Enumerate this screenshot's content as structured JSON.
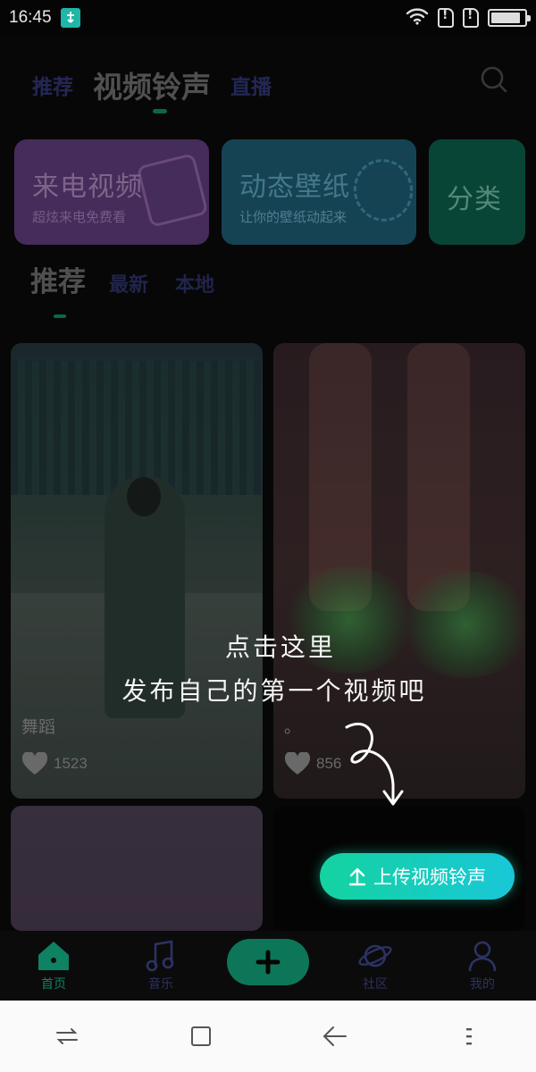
{
  "status_bar": {
    "time": "16:45",
    "battery_level": 0.9
  },
  "header": {
    "tabs": [
      {
        "label": "推荐",
        "active": false
      },
      {
        "label": "视频铃声",
        "active": true
      },
      {
        "label": "直播",
        "active": false
      }
    ]
  },
  "categories": [
    {
      "title": "来电视频",
      "subtitle": "超炫来电免费看"
    },
    {
      "title": "动态壁纸",
      "subtitle": "让你的壁纸动起来"
    },
    {
      "title": "分类",
      "subtitle": ""
    }
  ],
  "sub_tabs": [
    {
      "label": "推荐",
      "active": true
    },
    {
      "label": "最新",
      "active": false
    },
    {
      "label": "本地",
      "active": false
    }
  ],
  "videos": [
    {
      "title": "舞蹈",
      "likes": "1523"
    },
    {
      "title": "。",
      "likes": "856"
    }
  ],
  "guide": {
    "line1": "点击这里",
    "line2": "发布自己的第一个视频吧"
  },
  "upload_button": {
    "label": "上传视频铃声"
  },
  "bottom_nav": [
    {
      "label": "首页",
      "active": true
    },
    {
      "label": "音乐",
      "active": false
    },
    {
      "label": "",
      "active": false
    },
    {
      "label": "社区",
      "active": false
    },
    {
      "label": "我的",
      "active": false
    }
  ],
  "colors": {
    "accent": "#0e8262",
    "upload_gradient_start": "#14d3a0",
    "upload_gradient_end": "#19c7d8"
  }
}
